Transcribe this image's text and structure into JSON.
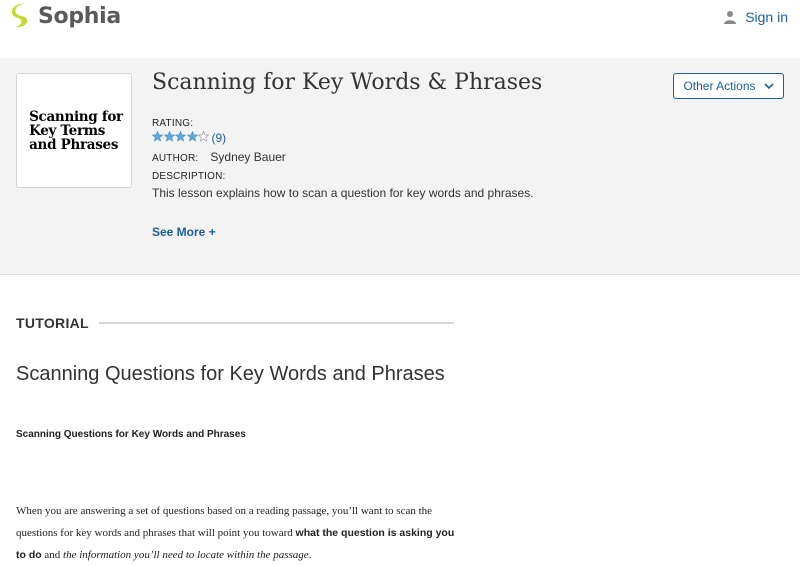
{
  "brand": {
    "name": "Sophia",
    "accent": "#c5d92d",
    "link_color": "#1d5f9a"
  },
  "header": {
    "signin_label": "Sign in",
    "signin_icon": "person-icon"
  },
  "lesson": {
    "thumbnail_text": "Scanning for\nKey Terms\nand Phrases",
    "title": "Scanning for Key Words & Phrases",
    "rating_label": "RATING:",
    "rating_value": 4,
    "rating_max": 5,
    "rating_count": "(9)",
    "author_label": "AUTHOR:",
    "author_name": "Sydney Bauer",
    "description_label": "DESCRIPTION:",
    "description": "This lesson explains how to scan a question for key words and phrases.",
    "see_more": "See More +",
    "other_actions": "Other Actions"
  },
  "tutorial": {
    "section_label": "TUTORIAL",
    "title": "Scanning Questions for Key Words and Phrases",
    "subtitle": "Scanning Questions for Key Words and Phrases",
    "body_part1": "When you are answering a set of questions based on a reading passage, you’ll want to scan the questions for key words and phrases that will point you toward ",
    "body_bold1": "what the question is asking you to do",
    "body_part2": " and ",
    "body_italic": "the information you’ll need to locate within the passage",
    "body_part3": "."
  }
}
